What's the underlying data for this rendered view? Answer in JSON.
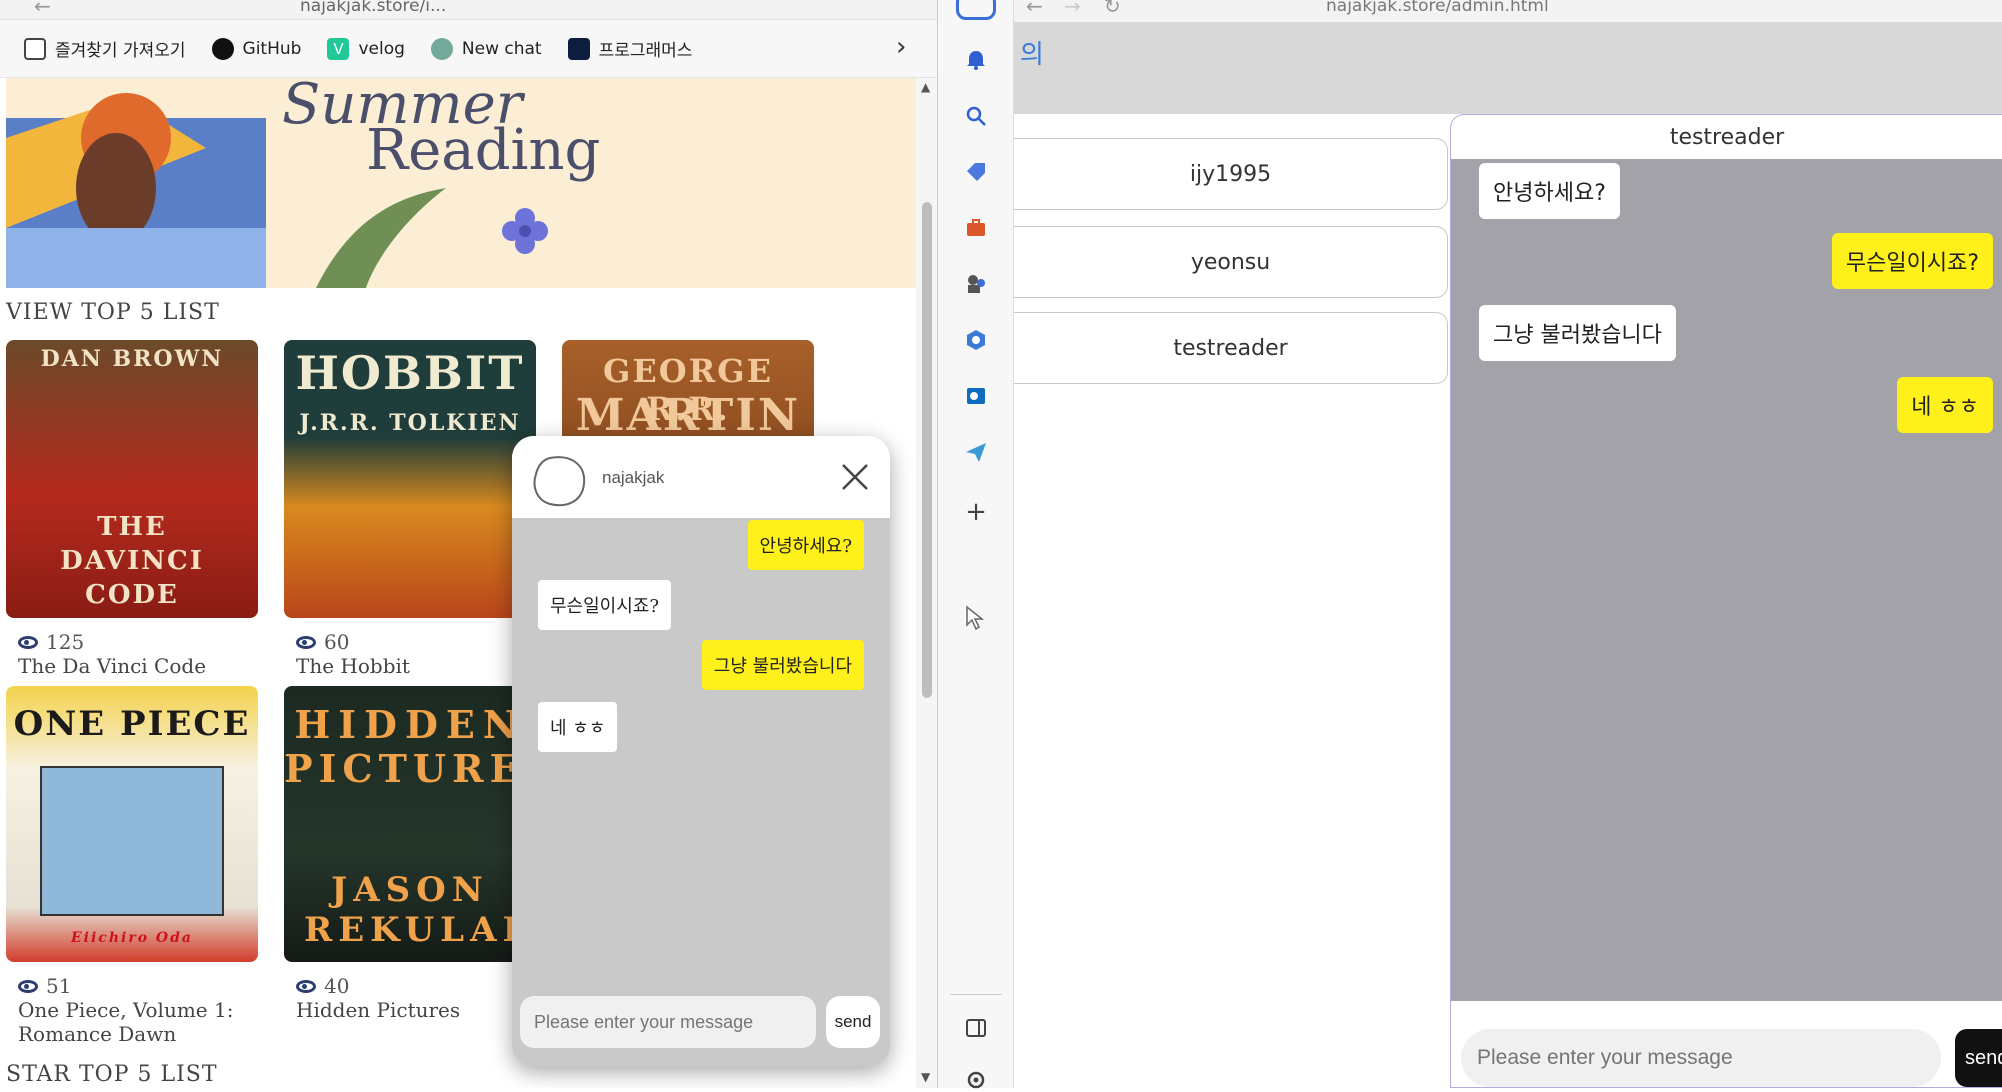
{
  "left_browser": {
    "url_fragment": "najakjak.store/i...",
    "bookmarks": [
      {
        "label": "즐겨찾기 가져오기",
        "icon": "import-favorites-icon"
      },
      {
        "label": "GitHub",
        "icon": "github-icon"
      },
      {
        "label": "velog",
        "icon": "velog-icon"
      },
      {
        "label": "New chat",
        "icon": "openai-icon"
      },
      {
        "label": "프로그래머스",
        "icon": "programmers-icon"
      }
    ],
    "bookmarks_more": "›",
    "banner": {
      "line1": "Summer",
      "line2": "Reading"
    },
    "view_top_title": "VIEW TOP 5 LIST",
    "star_top_title": "STAR TOP 5 LIST",
    "books": [
      {
        "cover_top": "DAN BROWN",
        "cover_main": "THE DAVINCI CODE",
        "views": "125",
        "title": "The Da Vinci Code"
      },
      {
        "cover_top": "HOBBIT",
        "cover_main": "J.R.R. TOLKIEN",
        "views": "60",
        "title": "The Hobbit"
      },
      {
        "cover_top": "GEORGE R.R.",
        "cover_main": "MARTIN"
      },
      {
        "cover_top": "ONE PIECE",
        "cover_main": "Eiichiro Oda",
        "views": "51",
        "title": "One Piece, Volume 1:",
        "title2": "Romance Dawn"
      },
      {
        "cover_top": "HIDDEN",
        "cover_main": "PICTURES",
        "cover_author": "JASON REKULAK",
        "views": "40",
        "title": "Hidden Pictures"
      }
    ]
  },
  "widget": {
    "name": "najakjak",
    "messages": [
      {
        "side": "right",
        "text": "안녕하세요?"
      },
      {
        "side": "left",
        "text": "무슨일이시죠?"
      },
      {
        "side": "right",
        "text": "그냥 불러봤습니다"
      },
      {
        "side": "left",
        "text": "네 ㅎㅎ"
      }
    ],
    "input_placeholder": "Please enter your message",
    "send_label": "send"
  },
  "right_browser": {
    "url_fragment": "najakjak.store/admin.html",
    "header_fragment": "의",
    "users": [
      "ijy1995",
      "yeonsu",
      "testreader"
    ],
    "chat_title": "testreader",
    "messages": [
      {
        "side": "left",
        "text": "안녕하세요?"
      },
      {
        "side": "right",
        "text": "무슨일이시죠?"
      },
      {
        "side": "left",
        "text": "그냥 불러봤습니다"
      },
      {
        "side": "right",
        "text": "네 ㅎㅎ"
      }
    ],
    "input_placeholder": "Please enter your message",
    "send_label": "send"
  },
  "colors": {
    "yellow_bubble": "#fef01b",
    "chat_bg": "#a2a2a8",
    "widget_bg": "#c9c9c9",
    "accent_purple": "#b9a9e0"
  }
}
